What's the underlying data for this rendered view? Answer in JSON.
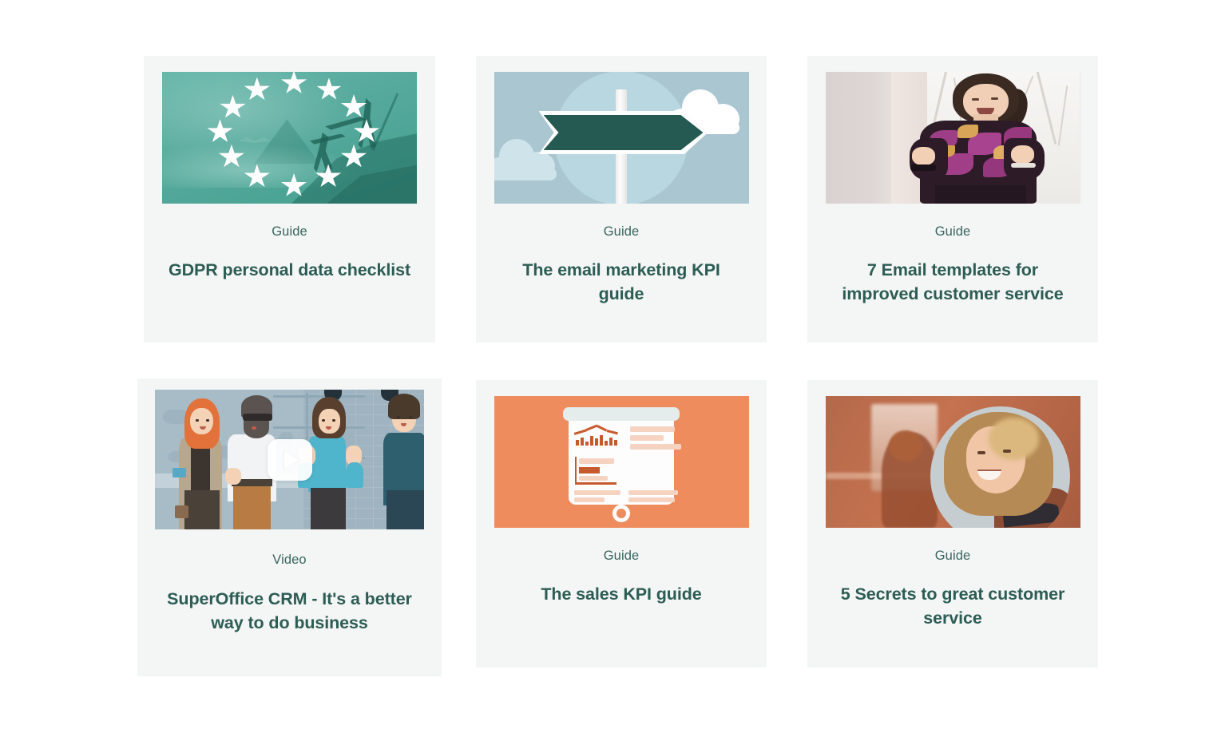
{
  "page": {
    "background_color": "#ffffff",
    "card_background_color": "#f4f5f5",
    "accent_text_color": "#2c5d54",
    "kicker_text_color": "#37665d"
  },
  "cards": [
    {
      "id": "gdpr-personal-data-checklist",
      "kicker": "Guide",
      "title": "GDPR personal data checklist",
      "thumbnail": {
        "name": "eu-stars-climbers-image",
        "kind": "illustration-photo",
        "dominant_color": "#4fa596"
      }
    },
    {
      "id": "email-marketing-kpi-guide",
      "kicker": "Guide",
      "title": "The email marketing KPI guide",
      "thumbnail": {
        "name": "signpost-illustration",
        "kind": "illustration",
        "dominant_color": "#a9c6d1"
      }
    },
    {
      "id": "7-email-templates-customer-service",
      "kicker": "Guide",
      "title": "7 Email templates for improved customer service",
      "thumbnail": {
        "name": "woman-cheering-photo",
        "kind": "photo",
        "dominant_color": "#e6dfdb"
      }
    },
    {
      "id": "superoffice-crm-video",
      "kicker": "Video",
      "title": "SuperOffice CRM - It's a better way to do business",
      "thumbnail": {
        "name": "video-thumbnail-illustrated-team",
        "kind": "video",
        "dominant_color": "#a8bcc7",
        "play_icon": "play-icon"
      }
    },
    {
      "id": "sales-kpi-guide",
      "kicker": "Guide",
      "title": "The sales KPI guide",
      "thumbnail": {
        "name": "presentation-board-illustration",
        "kind": "illustration",
        "dominant_color": "#ef8c5e"
      }
    },
    {
      "id": "5-secrets-great-customer-service",
      "kicker": "Guide",
      "title": "5 Secrets to great customer service",
      "thumbnail": {
        "name": "woman-smiling-photo",
        "kind": "photo",
        "dominant_color": "#b5694a"
      }
    }
  ]
}
